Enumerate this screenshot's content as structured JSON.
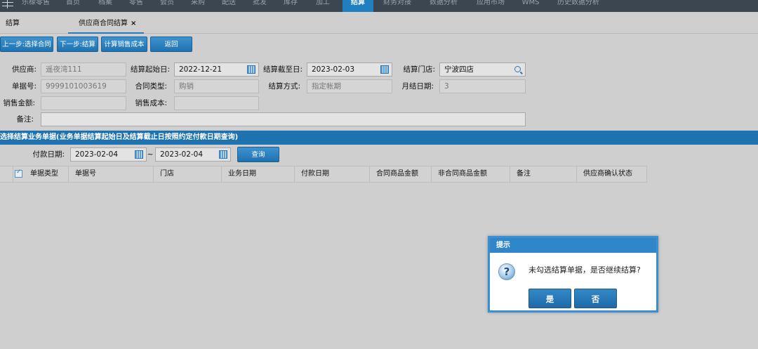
{
  "nav": {
    "items": [
      "乐檬零售",
      "首页",
      "档案",
      "零售",
      "会员",
      "采购",
      "配送",
      "批发",
      "库存",
      "加工",
      "结算",
      "财务对接",
      "数据分析",
      "应用市场",
      "WMS",
      "历史数据分析"
    ],
    "active_index": 10
  },
  "tabs": [
    {
      "label": "结算"
    },
    {
      "label": "供应商合同结算",
      "close": "×"
    }
  ],
  "toolbar": {
    "prev": "上一步:选择合同",
    "next": "下一步:结算",
    "calc": "计算销售成本",
    "back": "返回"
  },
  "form": {
    "supplier_label": "供应商:",
    "supplier_value": "遥夜湾111",
    "start_label": "结算起始日:",
    "start_value": "2022-12-21",
    "end_label": "结算截至日:",
    "end_value": "2023-02-03",
    "store_label": "结算门店:",
    "store_value": "宁波四店",
    "doc_label": "单据号:",
    "doc_value": "9999101003619",
    "contract_type_label": "合同类型:",
    "contract_type_value": "购销",
    "method_label": "结算方式:",
    "method_value": "指定帐期",
    "month_day_label": "月结日期:",
    "month_day_value": "3",
    "sales_amount_label": "销售金额:",
    "sales_amount_value": "",
    "sales_cost_label": "销售成本:",
    "sales_cost_value": "",
    "note_label": "备注:",
    "note_value": ""
  },
  "section": {
    "title": "选择结算业务单据(业务单据结算起始日及结算截止日按照约定付款日期查询)"
  },
  "filter": {
    "pay_date_label": "付款日期:",
    "from": "2023-02-04",
    "sep": "~",
    "to": "2023-02-04",
    "query": "查询"
  },
  "table": {
    "columns": [
      "单据类型",
      "单据号",
      "门店",
      "业务日期",
      "付款日期",
      "合同商品金额",
      "非合同商品金额",
      "备注",
      "供应商确认状态"
    ],
    "rows": []
  },
  "dialog": {
    "title": "提示",
    "icon": "question-icon",
    "message": "未勾选结算单据，是否继续结算?",
    "yes": "是",
    "no": "否"
  },
  "colors": {
    "accent": "#1f72b0",
    "nav_bg": "#3b4650",
    "background": "#cfcfcf"
  }
}
